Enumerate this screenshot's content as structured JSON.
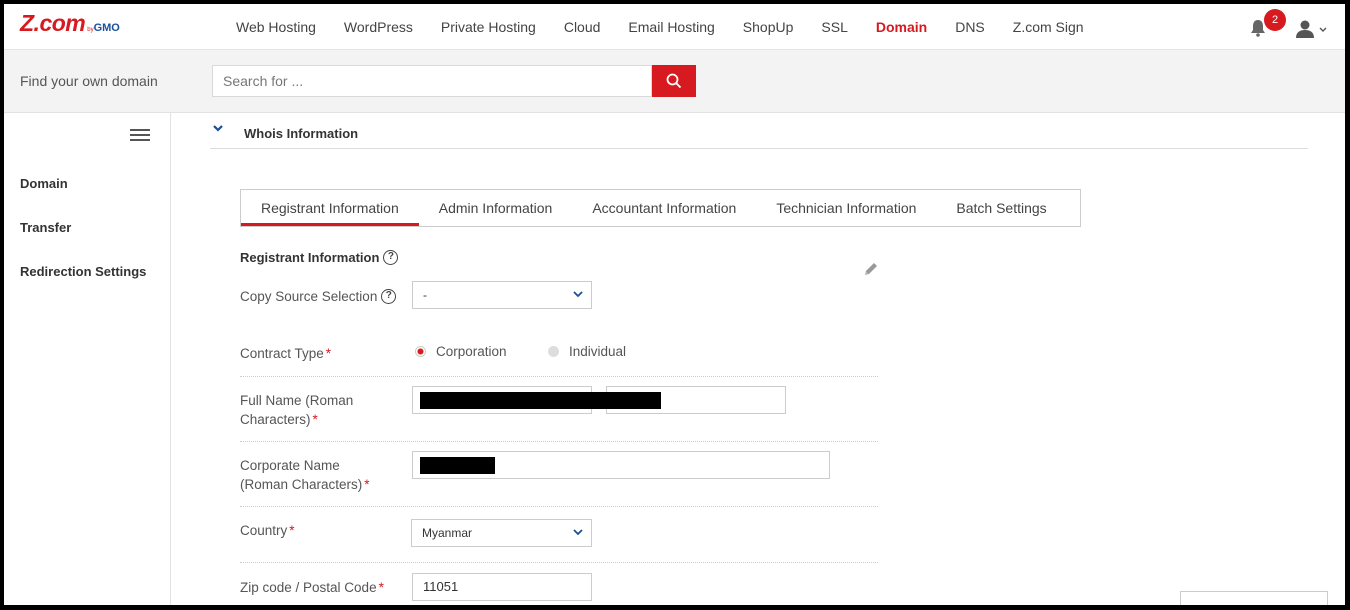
{
  "brand": {
    "name": "Z.com",
    "by": "by",
    "sub": "GMO"
  },
  "nav": {
    "items": [
      {
        "label": "Web Hosting"
      },
      {
        "label": "WordPress"
      },
      {
        "label": "Private Hosting"
      },
      {
        "label": "Cloud"
      },
      {
        "label": "Email Hosting"
      },
      {
        "label": "ShopUp"
      },
      {
        "label": "SSL"
      },
      {
        "label": "Domain",
        "active": true
      },
      {
        "label": "DNS"
      },
      {
        "label": "Z.com Sign"
      }
    ],
    "notification_count": "2"
  },
  "search": {
    "title": "Find your own domain",
    "placeholder": "Search for ..."
  },
  "sidebar": {
    "items": [
      {
        "label": "Domain"
      },
      {
        "label": "Transfer"
      },
      {
        "label": "Redirection Settings"
      }
    ]
  },
  "section": {
    "title": "Whois Information"
  },
  "tabs": [
    {
      "label": "Registrant Information",
      "active": true
    },
    {
      "label": "Admin Information"
    },
    {
      "label": "Accountant Information"
    },
    {
      "label": "Technician Information"
    },
    {
      "label": "Batch Settings"
    }
  ],
  "form": {
    "title": "Registrant Information",
    "copy_source_label": "Copy Source Selection",
    "copy_source_value": "-",
    "contract_type_label": "Contract Type",
    "contract_options": [
      "Corporation",
      "Individual"
    ],
    "contract_selected": "Corporation",
    "full_name_label_1": "Full Name (Roman",
    "full_name_label_2": "Characters)",
    "corporate_name_label_1": "Corporate Name",
    "corporate_name_label_2": "(Roman Characters)",
    "country_label": "Country",
    "country_value": "Myanmar",
    "zip_label": "Zip code / Postal Code",
    "zip_value": "11051",
    "required_mark": "*"
  },
  "colors": {
    "accent": "#d71920",
    "brand_blue": "#1b4f9c"
  }
}
